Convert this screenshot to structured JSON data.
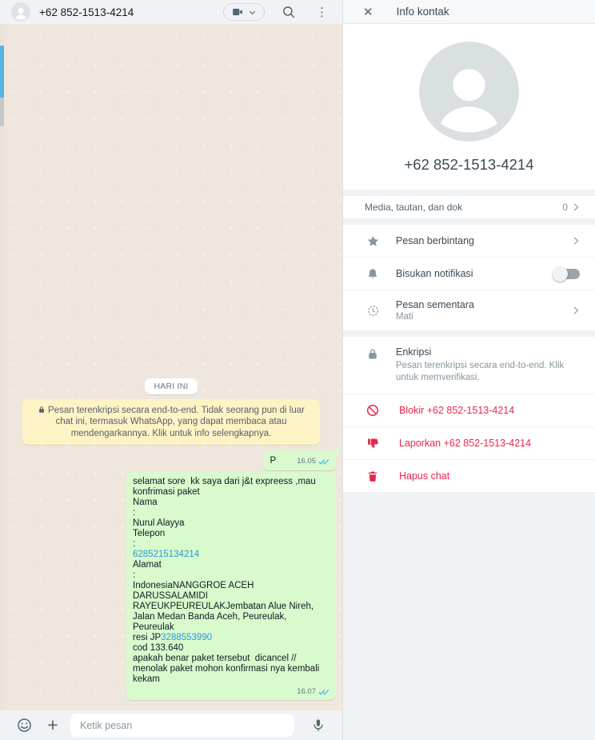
{
  "icons": {
    "close": "✕",
    "menu": "⋮",
    "plus": "+"
  },
  "colors": {
    "bubble_green": "#d8facd",
    "wallpaper": "#efe7dd",
    "notice_yellow": "#fdf3c5",
    "danger_red": "#e9264c",
    "link_blue": "#2a98d5",
    "check_blue": "#53bdeb",
    "panel_gray": "#f0f2f5",
    "scroll_thumb_blue": "#56b6e3"
  },
  "chat": {
    "header": {
      "title": "+62 852-1513-4214"
    },
    "date_chip": "HARI INI",
    "encryption_notice": "Pesan terenkripsi secara end-to-end. Tidak seorang pun di luar chat ini, termasuk WhatsApp, yang dapat membaca atau mendengarkannya. Klik untuk info selengkapnya.",
    "messages": [
      {
        "text": "P",
        "time": "16.05"
      },
      {
        "time": "16.07",
        "segments": [
          {
            "text": "selamat sore  kk saya dari j&t expreess ,mau konfrimasi paket\nNama\n:\nNurul Alayya\nTelepon\n:\n"
          },
          {
            "text": "6285215134214"
          },
          {
            "text": "\nAlamat\n:\nIndonesiaNANGGROE ACEH DARUSSALAMIDI RAYEUKPEUREULAKJembatan Alue Nireh, Jalan Medan Banda Aceh, Peureulak, Peureulak\nresi JP"
          },
          {
            "text": "3288553990"
          },
          {
            "text": "\ncod 133.640\napakah benar paket tersebut  dicancel // menolak paket mohon konfirmasi nya kembali kekam"
          }
        ]
      }
    ],
    "composer": {
      "placeholder": "Ketik pesan"
    }
  },
  "info_panel": {
    "title": "Info kontak",
    "phone": "+62 852-1513-4214",
    "media_row": {
      "label": "Media, tautan, dan dok",
      "count": "0"
    },
    "rows": {
      "starred": "Pesan berbintang",
      "mute": "Bisukan notifikasi",
      "disappearing": "Pesan sementara",
      "disappearing_value": "Mati",
      "encryption_title": "Enkripsi",
      "encryption_desc": "Pesan terenkripsi secara end-to-end. Klik untuk memverifikasi.",
      "block": "Blokir +62 852-1513-4214",
      "report": "Laporkan +62 852-1513-4214",
      "delete": "Hapus chat"
    }
  }
}
